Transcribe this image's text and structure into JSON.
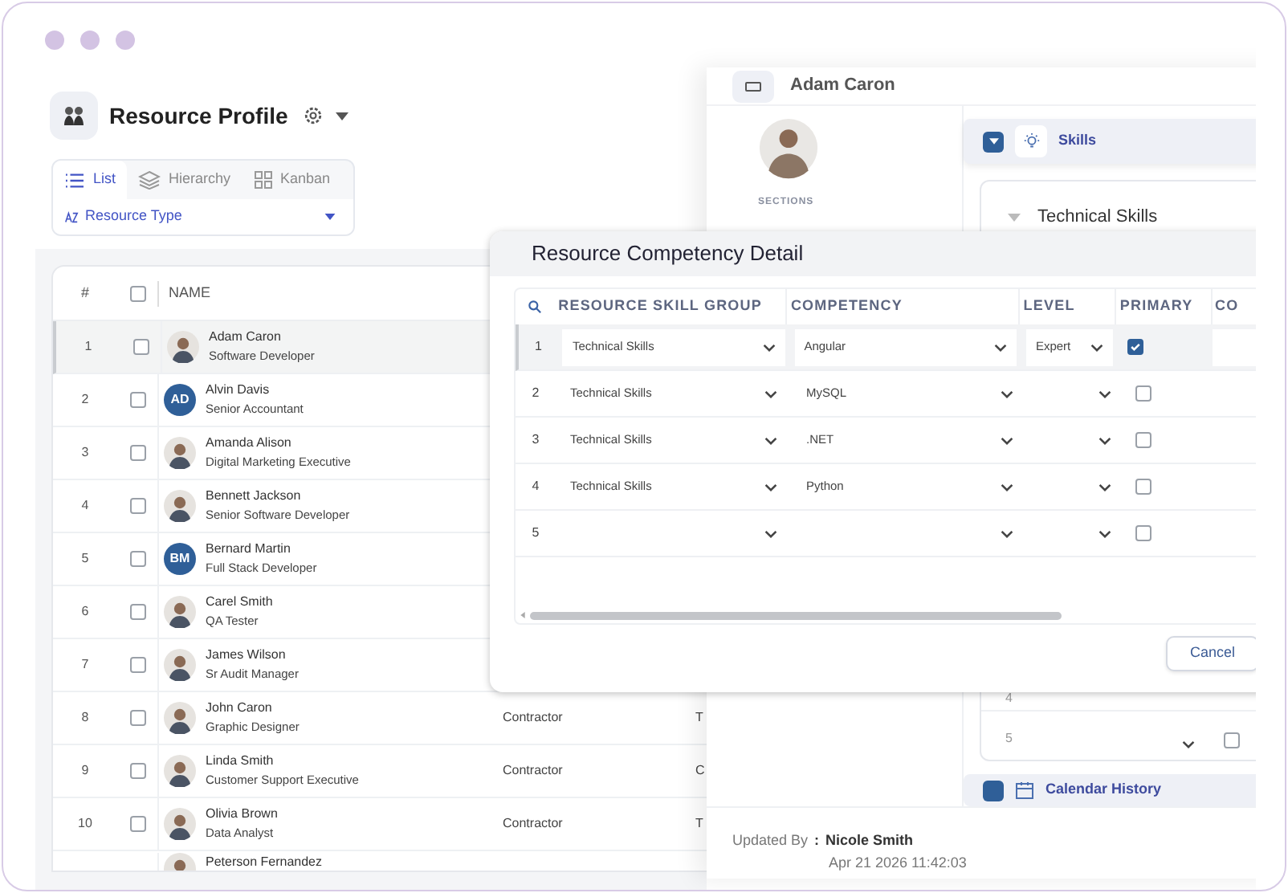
{
  "page": {
    "title": "Resource Profile"
  },
  "view_tabs": [
    {
      "label": "List",
      "kind": "list",
      "selected": true
    },
    {
      "label": "Hierarchy",
      "kind": "layers",
      "selected": false
    },
    {
      "label": "Kanban",
      "kind": "grid",
      "selected": false
    }
  ],
  "group_by": {
    "label": "Resource Type"
  },
  "table": {
    "columns": [
      "#",
      "NAME"
    ],
    "header_checked": false,
    "rows": [
      {
        "index": "1",
        "name": "Adam Caron",
        "role": "Software Developer",
        "avatar": {
          "kind": "photo"
        },
        "checked": false,
        "selected": true
      },
      {
        "index": "2",
        "name": "Alvin Davis",
        "role": "Senior Accountant",
        "avatar": {
          "kind": "initials",
          "text": "AD"
        },
        "checked": false,
        "selected": false
      },
      {
        "index": "3",
        "name": "Amanda Alison",
        "role": "Digital Marketing Executive",
        "avatar": {
          "kind": "photo"
        },
        "checked": false,
        "selected": false
      },
      {
        "index": "4",
        "name": "Bennett Jackson",
        "role": "Senior Software Developer",
        "avatar": {
          "kind": "photo"
        },
        "checked": false,
        "selected": false
      },
      {
        "index": "5",
        "name": "Bernard Martin",
        "role": "Full Stack Developer",
        "avatar": {
          "kind": "initials",
          "text": "BM"
        },
        "checked": false,
        "selected": false
      },
      {
        "index": "6",
        "name": "Carel Smith",
        "role": "QA Tester",
        "avatar": {
          "kind": "photo"
        },
        "checked": false,
        "selected": false
      },
      {
        "index": "7",
        "name": "James Wilson",
        "role": "Sr Audit Manager",
        "avatar": {
          "kind": "photo"
        },
        "checked": false,
        "selected": false
      },
      {
        "index": "8",
        "name": "John Caron",
        "role": "Graphic Designer",
        "avatar": {
          "kind": "photo"
        },
        "checked": false,
        "selected": false,
        "column_4": "Contractor",
        "column_5": "T"
      },
      {
        "index": "9",
        "name": "Linda Smith",
        "role": "Customer Support Executive",
        "avatar": {
          "kind": "photo"
        },
        "checked": false,
        "selected": false,
        "column_4": "Contractor",
        "column_5": "C"
      },
      {
        "index": "10",
        "name": "Olivia Brown",
        "role": "Data Analyst",
        "avatar": {
          "kind": "photo"
        },
        "checked": false,
        "selected": false,
        "column_4": "Contractor",
        "column_5": "T"
      },
      {
        "name": "Peterson Fernandez",
        "avatar": {
          "kind": "photo"
        }
      }
    ]
  },
  "detail": {
    "name": "Adam Caron",
    "sections_label": "SECTIONS",
    "skills": {
      "title": "Skills",
      "expanded": true
    },
    "group": {
      "title": "Technical Skills",
      "expanded": true,
      "rows": [
        {
          "index": "4"
        },
        {
          "index": "5",
          "checked": false
        }
      ]
    },
    "calendar": {
      "title": "Calendar History"
    },
    "updated_by": {
      "label": "Updated By",
      "separator": ":",
      "name": "Nicole Smith",
      "date": "Apr 21 2026 11:42:03"
    }
  },
  "modal": {
    "title": "Resource Competency Detail",
    "columns": [
      "RESOURCE SKILL GROUP",
      "COMPETENCY",
      "LEVEL",
      "PRIMARY",
      "CO"
    ],
    "rows": [
      {
        "index": "1",
        "skill_group": "Technical Skills",
        "competency": "Angular",
        "level": "Expert",
        "primary": true,
        "selected": true
      },
      {
        "index": "2",
        "skill_group": "Technical Skills",
        "competency": "MySQL",
        "primary": false,
        "selected": false
      },
      {
        "index": "3",
        "skill_group": "Technical Skills",
        "competency": ".NET",
        "primary": false,
        "selected": false
      },
      {
        "index": "4",
        "skill_group": "Technical Skills",
        "competency": "Python",
        "primary": false,
        "selected": false
      },
      {
        "index": "5",
        "primary": false,
        "selected": false
      }
    ],
    "cancel": "Cancel"
  }
}
